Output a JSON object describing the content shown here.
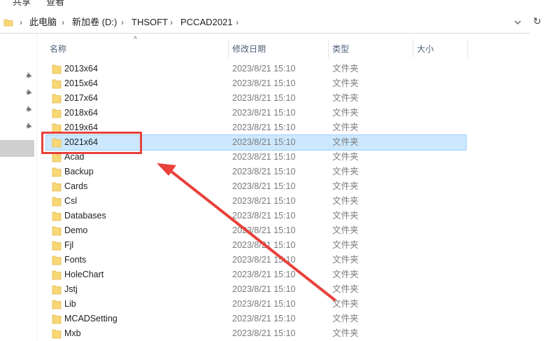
{
  "ribbon": {
    "tab1": "共享",
    "tab2": "查看"
  },
  "address_bar": {
    "crumbs": [
      "此电脑",
      "新加卷 (D:)",
      "THSOFT",
      "PCCAD2021"
    ]
  },
  "columns": {
    "name": "名称",
    "date": "修改日期",
    "type": "类型",
    "size": "大小"
  },
  "rows": [
    {
      "name": "2013x64",
      "date": "2023/8/21 15:10",
      "type": "文件夹"
    },
    {
      "name": "2015x64",
      "date": "2023/8/21 15:10",
      "type": "文件夹"
    },
    {
      "name": "2017x64",
      "date": "2023/8/21 15:10",
      "type": "文件夹"
    },
    {
      "name": "2018x64",
      "date": "2023/8/21 15:10",
      "type": "文件夹"
    },
    {
      "name": "2019x64",
      "date": "2023/8/21 15:10",
      "type": "文件夹"
    },
    {
      "name": "2021x64",
      "date": "2023/8/21 15:10",
      "type": "文件夹",
      "selected": true
    },
    {
      "name": "Acad",
      "date": "2023/8/21 15:10",
      "type": "文件夹"
    },
    {
      "name": "Backup",
      "date": "2023/8/21 15:10",
      "type": "文件夹"
    },
    {
      "name": "Cards",
      "date": "2023/8/21 15:10",
      "type": "文件夹"
    },
    {
      "name": "Csl",
      "date": "2023/8/21 15:10",
      "type": "文件夹"
    },
    {
      "name": "Databases",
      "date": "2023/8/21 15:10",
      "type": "文件夹"
    },
    {
      "name": "Demo",
      "date": "2023/8/21 15:10",
      "type": "文件夹"
    },
    {
      "name": "Fjl",
      "date": "2023/8/21 15:10",
      "type": "文件夹"
    },
    {
      "name": "Fonts",
      "date": "2023/8/21 15:10",
      "type": "文件夹"
    },
    {
      "name": "HoleChart",
      "date": "2023/8/21 15:10",
      "type": "文件夹"
    },
    {
      "name": "Jstj",
      "date": "2023/8/21 15:10",
      "type": "文件夹"
    },
    {
      "name": "Lib",
      "date": "2023/8/21 15:10",
      "type": "文件夹"
    },
    {
      "name": "MCADSetting",
      "date": "2023/8/21 15:10",
      "type": "文件夹"
    },
    {
      "name": "Mxb",
      "date": "2023/8/21 15:10",
      "type": "文件夹"
    }
  ],
  "icons": {
    "folder": "folder-icon",
    "pin": "pin-icon",
    "chevron": "chevron-right-icon",
    "dropdown": "chevron-down-icon",
    "refresh": "refresh-icon"
  },
  "colors": {
    "selection_bg": "#cce8ff",
    "selection_border": "#99d1ff",
    "annotation": "#e8413a",
    "folder": "#f8d775"
  }
}
